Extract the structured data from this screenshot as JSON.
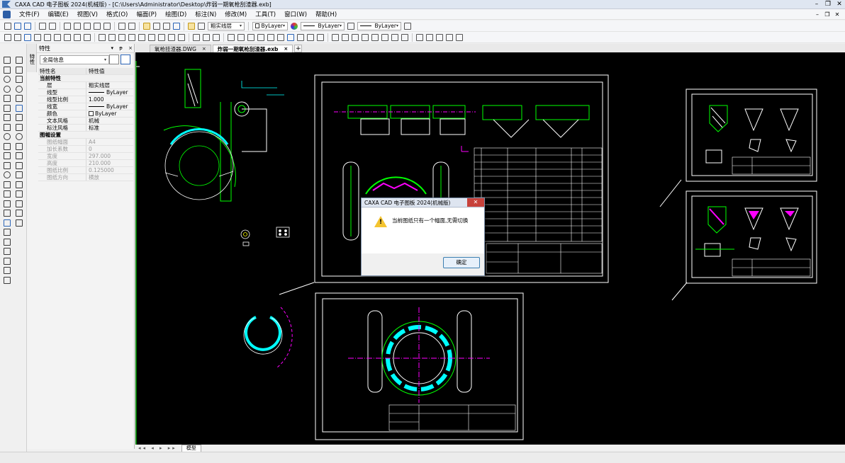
{
  "window": {
    "title": "CAXA CAD 电子图板 2024(机械版) - [C:\\Users\\Administrator\\Desktop\\炸弱一期氧枪刮渣器.exb]",
    "min_glyph": "–",
    "max_glyph": "❐",
    "close_glyph": "✕"
  },
  "menu": [
    "文件(F)",
    "编辑(E)",
    "视图(V)",
    "格式(O)",
    "幅面(P)",
    "绘图(D)",
    "标注(N)",
    "修改(M)",
    "工具(T)",
    "窗口(W)",
    "帮助(H)"
  ],
  "mdi_controls": [
    "–",
    "❐",
    "✕"
  ],
  "toolbar": {
    "layer_combo": "粗实线层",
    "color_combo": "ByLayer",
    "linetype_combo": "ByLayer",
    "lineweight_combo": "ByLayer"
  },
  "properties_panel": {
    "side_tab": "特性",
    "title": "特性",
    "header_controls": "▾ ᵽ ×",
    "filter_value": "全局信息",
    "col_name": "特性名",
    "col_value": "特性值",
    "categories": [
      {
        "name": "当前特性",
        "rows": [
          {
            "key": "层",
            "value": "粗实线层",
            "kind": "text"
          },
          {
            "key": "线型",
            "value": "ByLayer",
            "kind": "line"
          },
          {
            "key": "线型比例",
            "value": "1.000",
            "kind": "text"
          },
          {
            "key": "线宽",
            "value": "ByLayer",
            "kind": "line"
          },
          {
            "key": "颜色",
            "value": "ByLayer",
            "kind": "swatch"
          },
          {
            "key": "文本风格",
            "value": "机械",
            "kind": "text"
          },
          {
            "key": "标注风格",
            "value": "标准",
            "kind": "text"
          }
        ]
      },
      {
        "name": "图幅设置",
        "rows": [
          {
            "key": "图纸幅面",
            "value": "A4",
            "kind": "dis"
          },
          {
            "key": "加长系数",
            "value": "0",
            "kind": "dis"
          },
          {
            "key": "宽度",
            "value": "297.000",
            "kind": "dis"
          },
          {
            "key": "高度",
            "value": "210.000",
            "kind": "dis"
          },
          {
            "key": "图纸比例",
            "value": "0.125000",
            "kind": "dis"
          },
          {
            "key": "图纸方向",
            "value": "横放",
            "kind": "dis"
          }
        ]
      }
    ]
  },
  "tabs": [
    {
      "label": "氧枪挂渣器.DWG",
      "active": false
    },
    {
      "label": "炸弱一期氧枪刮渣器.exb",
      "active": true
    }
  ],
  "tab_close": "×",
  "tab_add": "+",
  "bottom": {
    "nav": "◂◂ ◂ ▸ ▸▸",
    "model_tab": "模型"
  },
  "dialog": {
    "title": "CAXA CAD 电子图板 2024(机械版)",
    "message": "当前图纸只有一个幅面,无需切换",
    "ok": "确定",
    "warn_mark": "!",
    "close_glyph": "✕"
  },
  "colors": {
    "canvas": "#000000",
    "cad_white": "#ffffff",
    "cad_green": "#00ff00",
    "cad_cyan": "#00ffff",
    "cad_magenta": "#ff00ff",
    "cad_yellow": "#ffff00"
  }
}
